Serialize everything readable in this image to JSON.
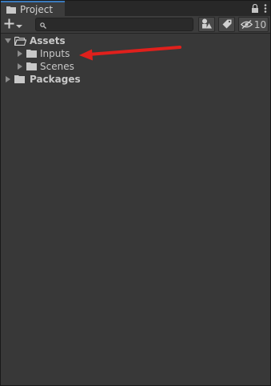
{
  "window": {
    "tab_title": "Project",
    "tab_icon": "folder-icon"
  },
  "toolbar": {
    "create_icon": "plus-icon",
    "search_value": "",
    "search_placeholder": "",
    "hidden_count": "10"
  },
  "tree": {
    "items": [
      {
        "label": "Assets",
        "expanded": true,
        "icon": "folder-open-icon"
      },
      {
        "label": "Inputs",
        "expanded": false,
        "icon": "folder-icon"
      },
      {
        "label": "Scenes",
        "expanded": false,
        "icon": "folder-icon"
      },
      {
        "label": "Packages",
        "expanded": false,
        "icon": "folder-icon"
      }
    ]
  },
  "colors": {
    "panel_bg": "#383838",
    "tab_accent": "#3a79bb",
    "arrow_annotation": "#e0201c"
  }
}
